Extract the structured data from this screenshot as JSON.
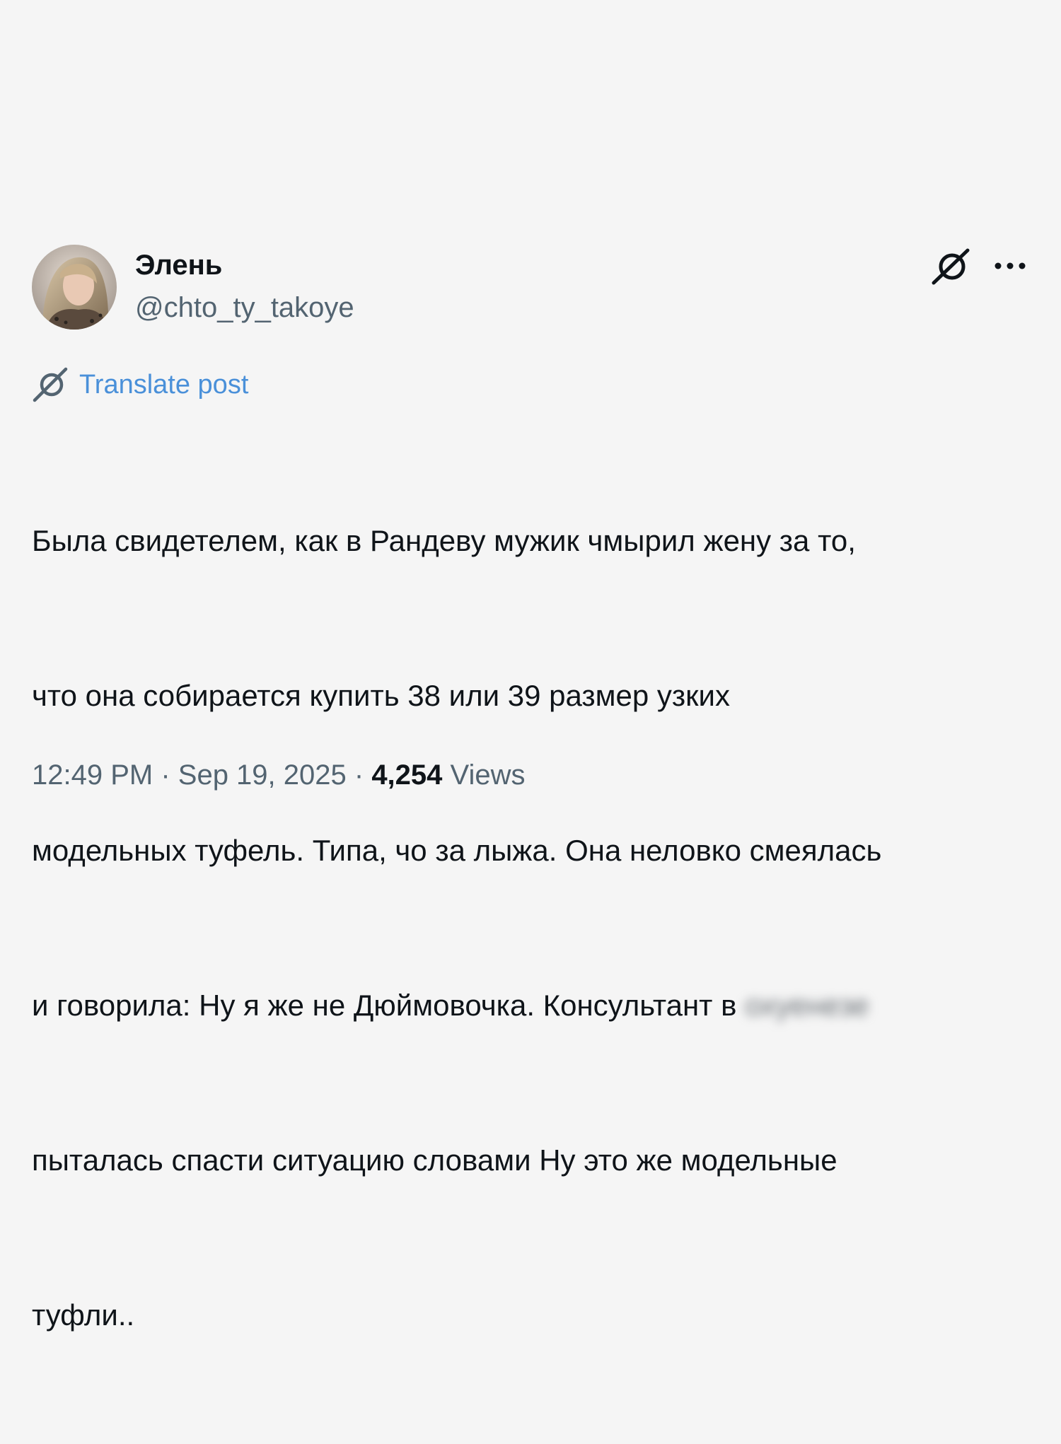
{
  "author": {
    "display_name": "Элень",
    "handle": "@chto_ty_takoye"
  },
  "header_icons": {
    "grok": "grok-icon",
    "more": "more-icon"
  },
  "translate": {
    "icon": "grok-icon",
    "label": "Translate post"
  },
  "post": {
    "lines": [
      "Была свидетелем, как в Рандеву мужик чмырил жену за то,",
      "что она собирается купить 38 или 39 размер узких",
      "модельных туфель. Типа, чо за лыжа. Она неловко смеялась",
      "и говорила: Ну я же не Дюймовочка. Консультант в ",
      "пыталась спасти ситуацию словами Ну это же модельные",
      "туфли.."
    ],
    "redacted_word": "охуенезе"
  },
  "meta": {
    "time": "12:49 PM",
    "separator": " · ",
    "date": "Sep 19, 2025",
    "views_count": "4,254",
    "views_label": " Views"
  },
  "colors": {
    "background": "#f5f5f5",
    "text_primary": "#0f1419",
    "text_secondary": "#536471",
    "link": "#4a90d9"
  }
}
